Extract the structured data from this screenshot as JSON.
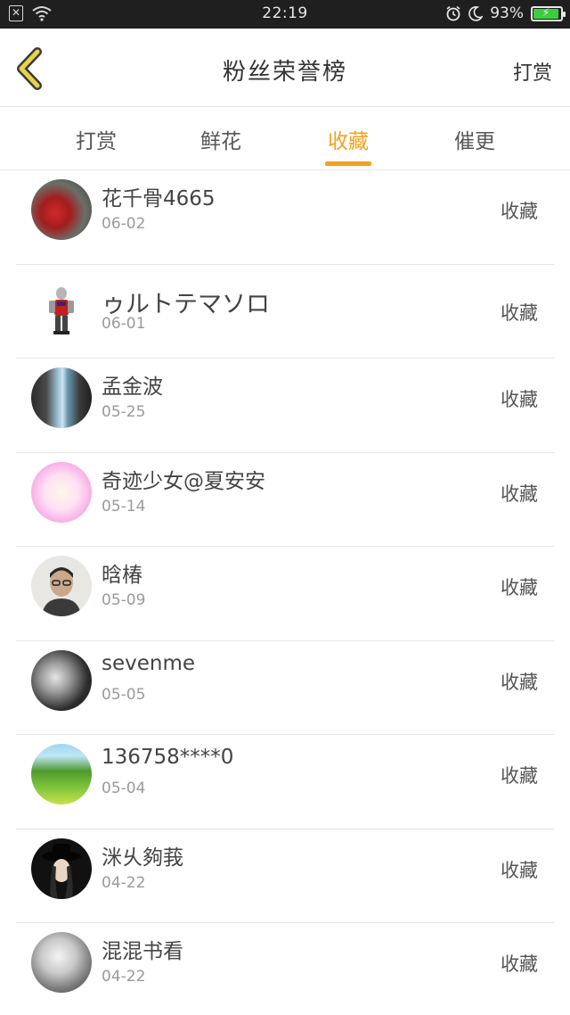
{
  "status_bar": {
    "time": "22:19",
    "battery": "93%",
    "battery_level": 0.93,
    "icons": [
      "close-box-icon",
      "wifi-icon",
      "alarm-icon",
      "moon-icon",
      "battery-charging-icon"
    ]
  },
  "header": {
    "title": "粉丝荣誉榜",
    "right_action": "打赏",
    "back_icon": "chevron-left-icon"
  },
  "tabs": [
    {
      "label": "打赏",
      "active": false
    },
    {
      "label": "鲜花",
      "active": false
    },
    {
      "label": "收藏",
      "active": true
    },
    {
      "label": "催更",
      "active": false
    }
  ],
  "colors": {
    "accent": "#f5a11c",
    "back_icon": "#e8d34a"
  },
  "fans": [
    {
      "name": "花千骨4665",
      "date": "06-02",
      "action": "收藏"
    },
    {
      "name": "ゥルトテマソロ",
      "date": "06-01",
      "action": "收藏"
    },
    {
      "name": "孟金波",
      "date": "05-25",
      "action": "收藏"
    },
    {
      "name": "奇迹少女@夏安安",
      "date": "05-14",
      "action": "收藏"
    },
    {
      "name": "晗椿",
      "date": "05-09",
      "action": "收藏"
    },
    {
      "name": "sevenme",
      "date": "05-05",
      "action": "收藏"
    },
    {
      "name": "136758****0",
      "date": "05-04",
      "action": "收藏"
    },
    {
      "name": "洣乆夠莪",
      "date": "04-22",
      "action": "收藏"
    },
    {
      "name": "混混书看",
      "date": "04-22",
      "action": "收藏"
    }
  ]
}
